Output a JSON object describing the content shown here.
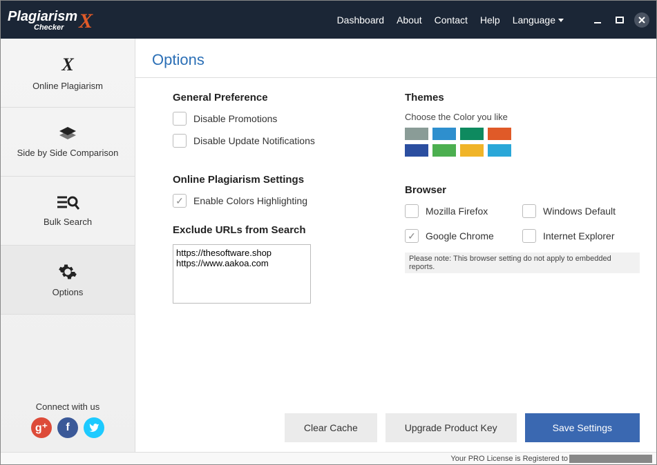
{
  "app": {
    "name1": "Plagiarism",
    "name2": "Checker"
  },
  "topnav": {
    "dashboard": "Dashboard",
    "about": "About",
    "contact": "Contact",
    "help": "Help",
    "language": "Language"
  },
  "sidebar": {
    "items": [
      {
        "label": "Online Plagiarism"
      },
      {
        "label": "Side by Side Comparison"
      },
      {
        "label": "Bulk Search"
      },
      {
        "label": "Options"
      }
    ],
    "connect": "Connect with us"
  },
  "page": {
    "title": "Options"
  },
  "general": {
    "heading": "General Preference",
    "disable_promotions": "Disable Promotions",
    "disable_updates": "Disable Update Notifications"
  },
  "online": {
    "heading": "Online Plagiarism Settings",
    "enable_colors": "Enable Colors Highlighting",
    "exclude_heading": "Exclude URLs from Search",
    "exclude_value": "https://thesoftware.shop\nhttps://www.aakoa.com"
  },
  "themes": {
    "heading": "Themes",
    "sub": "Choose the Color you like",
    "colors": [
      "#8a9c97",
      "#2e8fce",
      "#0e8a5f",
      "#e05a28",
      "#2b4ea0",
      "#4caf50",
      "#f0b428",
      "#2aa7d8"
    ]
  },
  "browser": {
    "heading": "Browser",
    "firefox": "Mozilla Firefox",
    "windows": "Windows Default",
    "chrome": "Google Chrome",
    "ie": "Internet Explorer",
    "note": "Please note: This browser setting do not apply to embedded reports."
  },
  "buttons": {
    "clear": "Clear Cache",
    "upgrade": "Upgrade Product Key",
    "save": "Save Settings"
  },
  "status": {
    "text": "Your PRO License is Registered to"
  }
}
